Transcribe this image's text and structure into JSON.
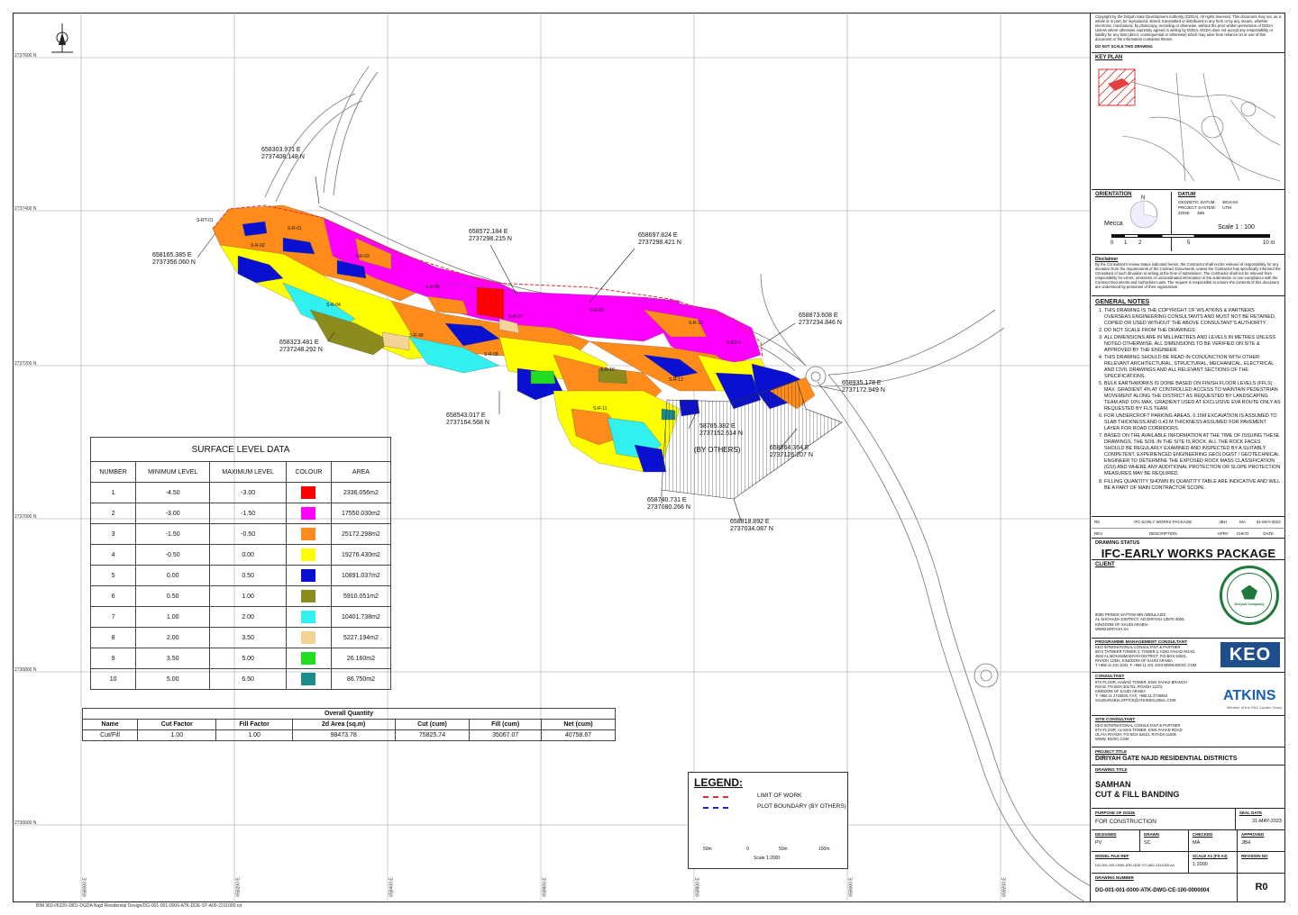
{
  "colors": {
    "level1": "#ff0000",
    "level2": "#ff00ff",
    "level3": "#ff8c1a",
    "level4": "#ffff00",
    "level5": "#0a10d0",
    "level6": "#8c8c1e",
    "level7": "#33f0f0",
    "level8": "#f5d296",
    "level9": "#22dd22",
    "level10": "#1a8c8c",
    "limit_of_work": "#e03030",
    "plot_boundary": "#2020d0"
  },
  "grid": {
    "northings": [
      "2737600 N",
      "2737400 N",
      "2737200 N",
      "2737000 N",
      "2736800 N",
      "2736600 N"
    ],
    "eastings": [
      "658000 E",
      "658200 E",
      "658400 E",
      "658600 E",
      "658800 E",
      "659000 E",
      "659200 E"
    ]
  },
  "coordinates": [
    {
      "e": "658303.971 E",
      "n": "2737408.148 N"
    },
    {
      "e": "658165.385 E",
      "n": "2737356.060 N"
    },
    {
      "e": "658572.184 E",
      "n": "2737298.215 N"
    },
    {
      "e": "658697.824 E",
      "n": "2737298.421 N"
    },
    {
      "e": "658873.608 E",
      "n": "2737234.846 N"
    },
    {
      "e": "658323.481 E",
      "n": "2737248.292 N"
    },
    {
      "e": "658935.178 E",
      "n": "2737172.949 N"
    },
    {
      "e": "658543.017 E",
      "n": "2737164.568 N"
    },
    {
      "e": "58765.382 E",
      "n": "2737152.614 N"
    },
    {
      "e": "658864.364 E",
      "n": "2737126.207 N"
    },
    {
      "e": "658740.731 E",
      "n": "2737080.266 N"
    },
    {
      "e": "658818.892 E",
      "n": "2737034.087 N"
    }
  ],
  "by_others": "(BY OTHERS)",
  "road_labels": [
    "S-RT-01",
    "S-R-01",
    "S-R-02",
    "S-R-03",
    "S-R-04",
    "S-R-05",
    "S-R-06",
    "S-R-07",
    "S-R-08",
    "S-R-09",
    "S-R-10",
    "S-R-11",
    "S-R-12",
    "S-R-13",
    "S-ED-1"
  ],
  "surface_table": {
    "title": "SURFACE LEVEL DATA",
    "headers": [
      "NUMBER",
      "MINIMUM LEVEL",
      "MAXIMUM LEVEL",
      "COLOUR",
      "AREA"
    ],
    "rows": [
      {
        "number": "1",
        "min": "-4.50",
        "max": "-3.00",
        "area": "2336.056m2"
      },
      {
        "number": "2",
        "min": "-3.00",
        "max": "-1.50",
        "area": "17550.030m2"
      },
      {
        "number": "3",
        "min": "-1.50",
        "max": "-0.50",
        "area": "25172.298m2"
      },
      {
        "number": "4",
        "min": "-0.50",
        "max": "0.00",
        "area": "19276.430m2"
      },
      {
        "number": "5",
        "min": "0.00",
        "max": "0.50",
        "area": "10891.037m2"
      },
      {
        "number": "6",
        "min": "0.50",
        "max": "1.00",
        "area": "5910.051m2"
      },
      {
        "number": "7",
        "min": "1.00",
        "max": "2.00",
        "area": "10401.738m2"
      },
      {
        "number": "8",
        "min": "2.00",
        "max": "3.50",
        "area": "5227.194m2"
      },
      {
        "number": "9",
        "min": "3.50",
        "max": "5.00",
        "area": "26.160m2"
      },
      {
        "number": "10",
        "min": "5.00",
        "max": "6.50",
        "area": "86.750m2"
      }
    ]
  },
  "quantity_table": {
    "title": "Overall Quantity",
    "headers": [
      "Name",
      "Cut Factor",
      "Fill Factor",
      "2d Area (sq.m)",
      "Cut (cum)",
      "Fill (cum)",
      "Net (cum)"
    ],
    "row": [
      "Cut/Fill",
      "1.00",
      "1.00",
      "98473.78",
      "75825.74",
      "35067.07",
      "40758.67"
    ]
  },
  "legend": {
    "title": "LEGEND:",
    "items": [
      "LIMIT OF WORK",
      "PLOT BOUNDARY (BY OTHERS)"
    ],
    "scale_ticks": [
      "50m",
      "0",
      "50m",
      "100m"
    ],
    "scale_label": "Scale 1:2000"
  },
  "footer_path": "BIM 360://6320-1801-DGDA Najd Residential Design/DG-001-001-0000-ATK-DDE-ST-A00-2311000.rvt",
  "title_block": {
    "copyright": "Copyright by the Diriyah Gate Development Authority (DGDA). All rights reserved. This document may not, as a whole or in part, be reproduced, stored, transmitted or distributed in any form or by any means, whether electronic, mechanical, by photocopy, recording or otherwise, without the prior written permission of DGDA. Unless where otherwise expressly agreed in writing by DGDA, DGDA does not accept any responsibility or liability for any loss (direct, consequential or otherwise) which may arise from reliance on or use of this document or the information contained therein.",
    "do_not_scale": "DO NOT SCALE THIS DRAWING",
    "key_plan": "KEY PLAN",
    "orientation": "ORIENTATION",
    "north": "N",
    "mecca": "Mecca",
    "datum_head": "DATUM",
    "datum_lines": [
      [
        "GEODETIC DATUM:",
        "WGS-84"
      ],
      [
        "PROJECT SYSTEM:",
        "UTM"
      ],
      [
        "ZONE:",
        "38N"
      ]
    ],
    "scale_text": "Scale 1 : 100",
    "scale_ticks": [
      "0",
      "1",
      "2",
      "5",
      "10 m"
    ],
    "disclaimer_head": "Disclaimer",
    "disclaimer": "By the Consultant's review status indicated herein, the Contractor shall not be relieved of responsibility for any deviation from the requirements of the Contract Documents, unless the Contractor has specifically informed the Consultant of such deviation in writing at the time of submission. The Contractor shall not be relieved from responsibility for errors, omissions or uncoordinated information in the submission or non-compliance with the Contract Documents and Authorities Laws. The request is responsible to ensure the contents of this document are understood by personnel of their organization.",
    "general_notes_head": "GENERAL NOTES",
    "notes": [
      "THIS DRAWING IS THE COPYRIGHT OF WS ATKINS & PARTNERS OVERSEAS ENGINEERING CONSULTANTS AND MUST NOT BE RETAINED, COPIED OR USED WITHOUT THE ABOVE CONSULTANT'S AUTHORITY.",
      "DO NOT SCALE FROM THE DRAWINGS.",
      "ALL DIMENSIONS ARE IN MILLIMETRES AND LEVELS IN METRES UNLESS NOTED OTHERWISE. ALL DIMENSIONS TO BE VERIFIED ON SITE & APPROVED BY THE ENGINEER.",
      "THIS DRAWING SHOULD BE READ IN CONJUNCTION WITH OTHER RELEVANT ARCHITECTURAL, STRUCTURAL, MECHANICAL, ELECTRICAL AND CIVIL DRAWINGS AND ALL RELEVANT SECTIONS OF THE SPECIFICATIONS.",
      "BULK EARTHWORKS IS DONE BASED ON FINISH FLOOR LEVELS (FFLS) MAX. GRADIENT 4% AT CONTROLLED ACCESS TO MAINTAIN PEDESTRIAN MOVEMENT ALONG THE DISTRICT AS REQUESTED BY LANDSCAPING TEAM AND 10% MAX. GRADIENT USED AT EXCLUSIVE EVA ROUTE ONLY AS REQUESTED BY FLS TEAM.",
      "FOR UNDERCROFT PARKING AREAS, 0.15M EXCAVATION IS ASSUMED TO SLAB THICKNESS AND 0.43 M THICKNESS ASSUMED FOR PAVEMENT LAYER FOR ROAD CORRIDORS.",
      "BASED ON THE AVAILABLE INFORMATION AT THE TIME OF ISSUING THESE DRAWINGS, THE SOIL IN THE SITE IS ROCK. ALL THE ROCK FACES SHOULD BE REGULARLY EXAMINED AND INSPECTED BY A SUITABLY COMPETENT, EXPERIENCED ENGINEERING GEOLOGIST / GEOTECHNICAL ENGINEER TO DETERMINE THE EXPOSED ROCK MASS CLASSIFICATION (GSI) AND WHERE ANY ADDITIONAL PROTECTION OR SLOPE PROTECTION MEASURES MAY BE REQUIRED.",
      "FILLING QUANTITY SHOWN IN QUANTITY TABLE ARE INDICATIVE AND WILL BE A PART OF MAIN CONTRACTOR SCOPE."
    ],
    "revision_row": [
      "R0",
      "IFC-EARLY WORKS PACKAGE",
      "JBH",
      "MA",
      "31-MAY-2023"
    ],
    "revision_headers": [
      "REV",
      "DESCRIPTION",
      "APRV",
      "CHK'D",
      "DATE"
    ],
    "drawing_status_label": "DRAWING STATUS",
    "drawing_status": "IFC-EARLY WORKS PACKAGE",
    "client_label": "CLIENT",
    "client_address": [
      "8000 PRINCE SATTAM IBN ABDULAZIZ,",
      "AL SHOHADA DISTRICT, AD DIRIYAH 13670-4000,",
      "KINGDOM OF SAUDI ARABIA",
      "WWW.DIRIYAH.SA"
    ],
    "client_logo_text": "Diriyah Company",
    "pmc_label": "PROGRAMME MANAGEMENT CONSULTANT",
    "pmc_address": [
      "KEO INTERNATIONAL CONSULTANT & PARTNER",
      "6572 TATWEER TOWER 3, TOWER 2, KING FAHAD ROAD,",
      "4942 AL MOHAMMADIYAH DISTRICT, P.O.BOX 62621,",
      "RIYADH 12361, KINGDOM OF SAUDI ARABIA",
      "T +966 11 201 2042, F +966 11 201 1023   WWW.KEOIC.COM"
    ],
    "keo": "KEO",
    "consultant_label": "CONSULTANT",
    "consultant_address": [
      "6TH FLOOR, HAWAD TOWER, KING FAHAD BRANCH",
      "ROAD, PO BOX 301702, RIYADH 11372,",
      "KINGDOM OF SAUDI ARABIA",
      "T: +966 11 2734825, FAX: +966 11 2745653",
      "SAUDIARABIA.OFFICE@ATKINSGLOBAL.COM"
    ],
    "atkins": "ATKINS",
    "atkins_sub": "Member of the SNC-Lavalin Group",
    "site_consultant_label": "SITE CONSULTANT",
    "site_consultant_address": [
      "KEO INTERNATIONAL CONSULTANT & PARTNER",
      "5TH FLOOR, AL-MAS TOWER, KING FAHAD ROAD",
      "OLAYA RIYADH, P.O BOX 62621, RIYADH 11595",
      "WWW. KEOIC.COM"
    ],
    "project_title_label": "PROJECT TITLE",
    "project_title": "DIRIYAH GATE NAJD RESIDENTIAL DISTRICTS",
    "drawing_title_label": "DRAWING TITLE",
    "drawing_title_1": "SAMHAN",
    "drawing_title_2": "CUT & FILL BANDING",
    "purpose_label": "PURPOSE OF ISSUE",
    "purpose": "FOR CONSTRUCTION",
    "seal_date_label": "SEAL DATE",
    "seal_date": "31-MAY-2023",
    "designed_label": "DESIGNED",
    "designed": "PV",
    "drawn_label": "DRAWN",
    "drawn": "SC",
    "checked_label": "CHECKED",
    "checked": "MA",
    "approved_label": "APPROVED",
    "approved": "JBH",
    "model_file_label": "MODEL FILE REF",
    "model_file": "DG-001-001-0000-ATK-DDE-ST-A00-2311000.rvt",
    "scale_label": "SCALE A1 (Fit A3)",
    "scale": "1:2000",
    "revision_no_label": "REVISION NO",
    "drawing_number_label": "DRAWING NUMBER",
    "drawing_number": "DG-001-001-0000-ATK-DWG-CE-100-0000004",
    "revision": "R0"
  }
}
